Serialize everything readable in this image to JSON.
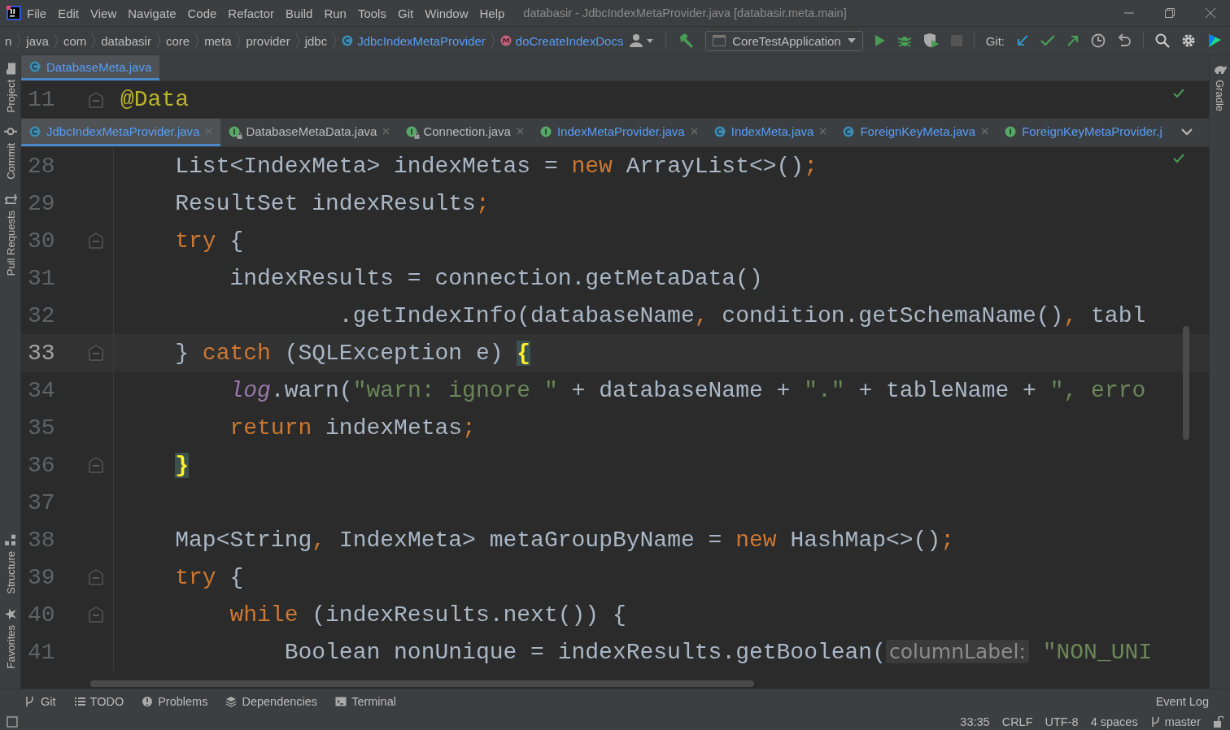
{
  "menu": [
    "File",
    "Edit",
    "View",
    "Navigate",
    "Code",
    "Refactor",
    "Build",
    "Run",
    "Tools",
    "Git",
    "Window",
    "Help"
  ],
  "window": {
    "title": "databasir - JdbcIndexMetaProvider.java [databasir.meta.main]"
  },
  "breadcrumbs": [
    {
      "label": "n",
      "kind": "folder"
    },
    {
      "label": "java",
      "kind": "folder"
    },
    {
      "label": "com",
      "kind": "folder"
    },
    {
      "label": "databasir",
      "kind": "folder"
    },
    {
      "label": "core",
      "kind": "folder"
    },
    {
      "label": "meta",
      "kind": "folder"
    },
    {
      "label": "provider",
      "kind": "folder"
    },
    {
      "label": "jdbc",
      "kind": "folder"
    },
    {
      "label": "JdbcIndexMetaProvider",
      "kind": "class"
    },
    {
      "label": "doCreateIndexDocs",
      "kind": "method"
    }
  ],
  "toolbar": {
    "run_config": "CoreTestApplication",
    "git_label": "Git:"
  },
  "top_tabs": [
    {
      "label": "DatabaseMeta.java",
      "kind": "class",
      "changed": true,
      "selected": true
    }
  ],
  "sticky_line": {
    "number": "11",
    "fold": true,
    "tokens": [
      {
        "t": "@Data",
        "kind": "annotation"
      }
    ]
  },
  "editor_tabs": [
    {
      "label": "JdbcIndexMetaProvider.java",
      "kind": "class",
      "changed": true,
      "locked": false,
      "closable": true,
      "selected": true
    },
    {
      "label": "DatabaseMetaData.java",
      "kind": "interface",
      "changed": false,
      "locked": true,
      "closable": true,
      "selected": false
    },
    {
      "label": "Connection.java",
      "kind": "interface",
      "changed": false,
      "locked": true,
      "closable": true,
      "selected": false
    },
    {
      "label": "IndexMetaProvider.java",
      "kind": "interface",
      "changed": true,
      "locked": false,
      "closable": true,
      "selected": false
    },
    {
      "label": "IndexMeta.java",
      "kind": "class",
      "changed": true,
      "locked": false,
      "closable": true,
      "selected": false
    },
    {
      "label": "ForeignKeyMeta.java",
      "kind": "class",
      "changed": true,
      "locked": false,
      "closable": true,
      "selected": false
    },
    {
      "label": "ForeignKeyMetaProvider.j",
      "kind": "interface",
      "changed": true,
      "locked": false,
      "closable": false,
      "selected": false
    }
  ],
  "code_lines": [
    {
      "number": "28",
      "current": false,
      "fold": false,
      "tokens": [
        {
          "t": "    List<IndexMeta> indexMetas = ",
          "kind": "plain"
        },
        {
          "t": "new",
          "kind": "keyword"
        },
        {
          "t": " ArrayList<>()",
          "kind": "plain"
        },
        {
          "t": ";",
          "kind": "punct"
        }
      ]
    },
    {
      "number": "29",
      "current": false,
      "fold": false,
      "tokens": [
        {
          "t": "    ResultSet indexResults",
          "kind": "plain"
        },
        {
          "t": ";",
          "kind": "punct"
        }
      ]
    },
    {
      "number": "30",
      "current": false,
      "fold": true,
      "tokens": [
        {
          "t": "    try",
          "kind": "keyword"
        },
        {
          "t": " {",
          "kind": "plain"
        }
      ]
    },
    {
      "number": "31",
      "current": false,
      "fold": false,
      "tokens": [
        {
          "t": "        indexResults = connection.getMetaData()",
          "kind": "plain"
        }
      ]
    },
    {
      "number": "32",
      "current": false,
      "fold": false,
      "tokens": [
        {
          "t": "                .getIndexInfo(databaseName",
          "kind": "plain"
        },
        {
          "t": ",",
          "kind": "punct"
        },
        {
          "t": " condition.getSchemaName()",
          "kind": "plain"
        },
        {
          "t": ",",
          "kind": "punct"
        },
        {
          "t": " tabl",
          "kind": "plain"
        }
      ]
    },
    {
      "number": "33",
      "current": true,
      "fold": true,
      "tokens": [
        {
          "t": "    } ",
          "kind": "plain"
        },
        {
          "t": "catch",
          "kind": "keyword"
        },
        {
          "t": " (SQLException e) ",
          "kind": "plain"
        },
        {
          "t": "{",
          "kind": "match"
        }
      ]
    },
    {
      "number": "34",
      "current": false,
      "fold": false,
      "tokens": [
        {
          "t": "        log",
          "kind": "field"
        },
        {
          "t": ".warn(",
          "kind": "plain"
        },
        {
          "t": "\"warn: ignore \"",
          "kind": "string"
        },
        {
          "t": " + databaseName + ",
          "kind": "plain"
        },
        {
          "t": "\".\"",
          "kind": "string"
        },
        {
          "t": " + tableName + ",
          "kind": "plain"
        },
        {
          "t": "\", erro",
          "kind": "string"
        }
      ]
    },
    {
      "number": "35",
      "current": false,
      "fold": false,
      "tokens": [
        {
          "t": "        return",
          "kind": "keyword"
        },
        {
          "t": " indexMetas",
          "kind": "plain"
        },
        {
          "t": ";",
          "kind": "punct"
        }
      ]
    },
    {
      "number": "36",
      "current": false,
      "fold": true,
      "tokens": [
        {
          "t": "    }",
          "kind": "match"
        }
      ]
    },
    {
      "number": "37",
      "current": false,
      "fold": false
    },
    {
      "number": "38",
      "current": false,
      "fold": false,
      "tokens": [
        {
          "t": "    Map<String",
          "kind": "plain"
        },
        {
          "t": ",",
          "kind": "punct"
        },
        {
          "t": " IndexMeta> metaGroupByName = ",
          "kind": "plain"
        },
        {
          "t": "new",
          "kind": "keyword"
        },
        {
          "t": " HashMap<>()",
          "kind": "plain"
        },
        {
          "t": ";",
          "kind": "punct"
        }
      ]
    },
    {
      "number": "39",
      "current": false,
      "fold": true,
      "tokens": [
        {
          "t": "    try",
          "kind": "keyword"
        },
        {
          "t": " {",
          "kind": "plain"
        }
      ]
    },
    {
      "number": "40",
      "current": false,
      "fold": true,
      "tokens": [
        {
          "t": "        while",
          "kind": "keyword"
        },
        {
          "t": " (indexResults.next()) {",
          "kind": "plain"
        }
      ]
    },
    {
      "number": "41",
      "current": false,
      "fold": false,
      "tokens": [
        {
          "t": "            Boolean nonUnique = indexResults.getBoolean(",
          "kind": "plain"
        },
        {
          "t": "columnLabel:",
          "kind": "hint"
        },
        {
          "t": " \"NON_UNI",
          "kind": "string"
        }
      ]
    }
  ],
  "left_tools": [
    {
      "label": "Project"
    },
    {
      "label": "Commit"
    },
    {
      "label": "Pull Requests"
    },
    {
      "label": "Structure"
    },
    {
      "label": "Favorites"
    }
  ],
  "right_tools": [
    "Gradle"
  ],
  "bottom_tools": [
    {
      "label": "Git"
    },
    {
      "label": "TODO"
    },
    {
      "label": "Problems"
    },
    {
      "label": "Dependencies"
    },
    {
      "label": "Terminal"
    }
  ],
  "event_log": "Event Log",
  "status_bar": {
    "position": "33:35",
    "line_separator": "CRLF",
    "encoding": "UTF-8",
    "indent": "4 spaces",
    "branch": "master"
  }
}
